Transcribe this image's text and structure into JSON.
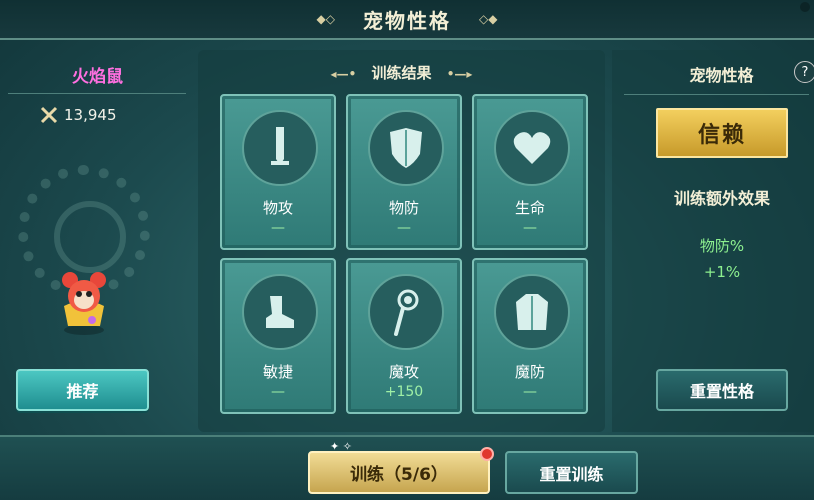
{
  "header": {
    "title": "宠物性格"
  },
  "left": {
    "pet_name": "火焰鼠",
    "power": "13,945",
    "recommend_label": "推荐"
  },
  "center": {
    "title": "训练结果",
    "stats": [
      {
        "label": "物攻",
        "value": "—",
        "icon": "sword-icon"
      },
      {
        "label": "物防",
        "value": "—",
        "icon": "shield-icon"
      },
      {
        "label": "生命",
        "value": "—",
        "icon": "heart-icon"
      },
      {
        "label": "敏捷",
        "value": "—",
        "icon": "boot-icon"
      },
      {
        "label": "魔攻",
        "value": "+150",
        "icon": "magic-staff-icon"
      },
      {
        "label": "魔防",
        "value": "—",
        "icon": "robe-icon"
      }
    ]
  },
  "right": {
    "title": "宠物性格",
    "help": "?",
    "trait": "信赖",
    "extra_label": "训练额外效果",
    "extra_stat": "物防%",
    "extra_value": "+1%",
    "reset_trait_label": "重置性格"
  },
  "bottom": {
    "train_label": "训练（5/6）",
    "reset_train_label": "重置训练"
  },
  "colors": {
    "accent_gold": "#f3cf5e",
    "pet_name": "#ff6fe0",
    "bonus_green": "#8df08f"
  }
}
